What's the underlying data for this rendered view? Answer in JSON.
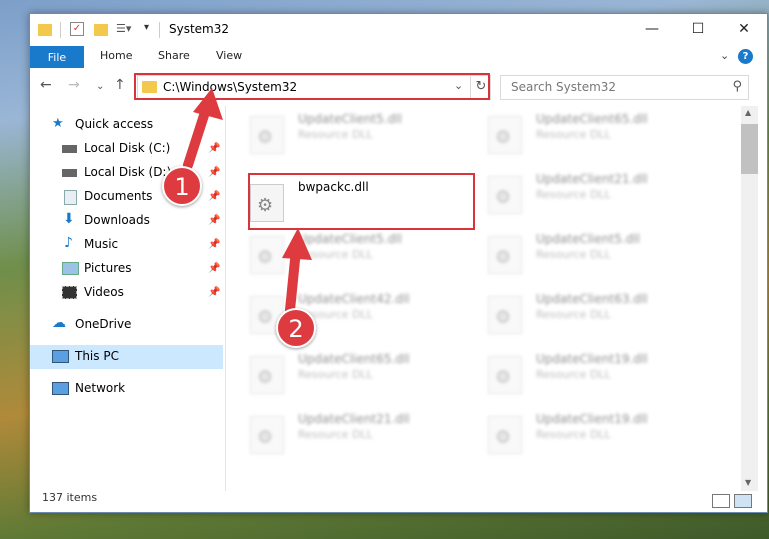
{
  "window": {
    "title": "System32"
  },
  "ribbon": {
    "file": "File",
    "home": "Home",
    "share": "Share",
    "view": "View",
    "help": "?"
  },
  "address": {
    "path": "C:\\Windows\\System32"
  },
  "search": {
    "placeholder": "Search System32"
  },
  "sidebar": {
    "items": [
      {
        "label": "Quick access"
      },
      {
        "label": "Local Disk (C:)"
      },
      {
        "label": "Local Disk (D:)"
      },
      {
        "label": "Documents"
      },
      {
        "label": "Downloads"
      },
      {
        "label": "Music"
      },
      {
        "label": "Pictures"
      },
      {
        "label": "Videos"
      },
      {
        "label": "OneDrive"
      },
      {
        "label": "This PC"
      },
      {
        "label": "Network"
      }
    ]
  },
  "files": [
    {
      "name": "UpdateClient5.dll",
      "type": "Resource DLL"
    },
    {
      "name": "UpdateClient65.dll",
      "type": "Resource DLL"
    },
    {
      "name": "bwpackc.dll",
      "type": ""
    },
    {
      "name": "UpdateClient21.dll",
      "type": "Resource DLL"
    },
    {
      "name": "UpdateClient5.dll",
      "type": "Resource DLL"
    },
    {
      "name": "UpdateClient5.dll",
      "type": "Resource DLL"
    },
    {
      "name": "UpdateClient42.dll",
      "type": "Resource DLL"
    },
    {
      "name": "UpdateClient63.dll",
      "type": "Resource DLL"
    },
    {
      "name": "UpdateClient65.dll",
      "type": "Resource DLL"
    },
    {
      "name": "UpdateClient19.dll",
      "type": "Resource DLL"
    },
    {
      "name": "UpdateClient21.dll",
      "type": "Resource DLL"
    },
    {
      "name": "UpdateClient19.dll",
      "type": "Resource DLL"
    }
  ],
  "status": {
    "item_count": "137 items"
  },
  "markers": {
    "one": "1",
    "two": "2"
  },
  "colors": {
    "highlight": "#d9343b",
    "accent": "#1979ca",
    "marker": "#dd3b3f"
  }
}
